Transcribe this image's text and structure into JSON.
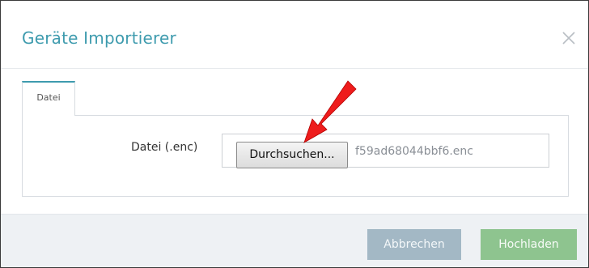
{
  "dialog": {
    "title": "Geräte Importierer",
    "close_icon": "close-icon"
  },
  "tabs": [
    {
      "label": "Datei",
      "active": true
    }
  ],
  "file_input": {
    "label": "Datei (.enc)",
    "browse_label": "Durchsuchen...",
    "file_name": "f59ad68044bbf6.enc"
  },
  "footer": {
    "cancel_label": "Abbrechen",
    "upload_label": "Hochladen"
  },
  "annotation": {
    "arrow_icon": "red-arrow-icon",
    "arrow_color": "#ee1c1c"
  },
  "colors": {
    "accent": "#3e9bae",
    "cancel": "#a3b8c5",
    "upload": "#8ec48f"
  }
}
